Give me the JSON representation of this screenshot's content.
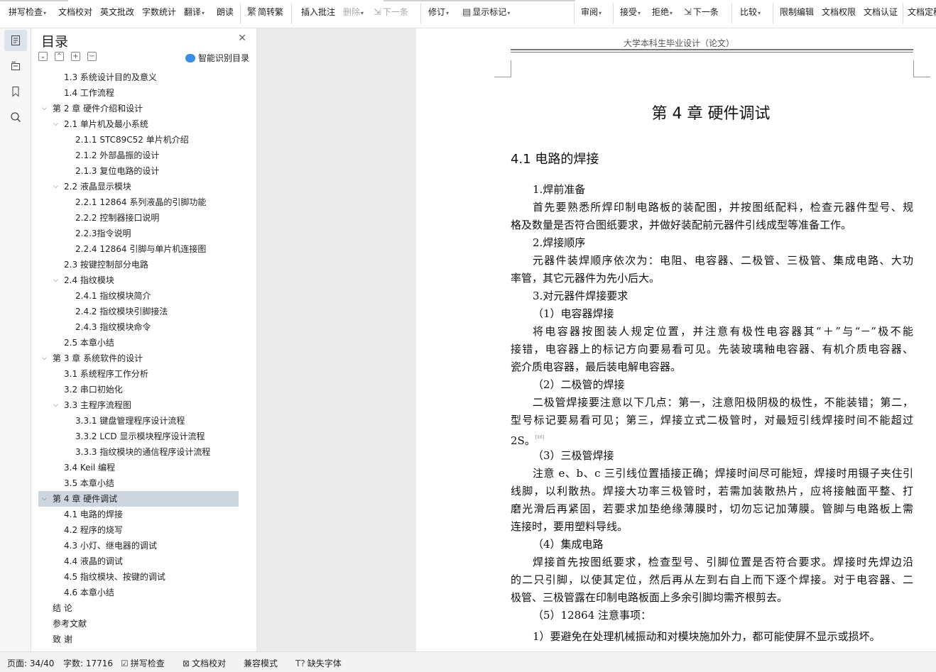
{
  "ribbon": {
    "spell_check": "拼写检查",
    "doc_proof": "文档校对",
    "en_review": "英文批改",
    "word_count": "字数统计",
    "translate": "翻译",
    "read_aloud": "朗读",
    "simp_trad": "简转繁",
    "insert_comment": "插入批注",
    "delete": "删除",
    "next": "下一条",
    "track_changes": "修订",
    "show_markup": "显示标记",
    "review": "审阅",
    "accept": "接受",
    "reject": "拒绝",
    "next_change": "下一条",
    "compare": "比较",
    "restrict_edit": "限制编辑",
    "doc_permission": "文档权限",
    "doc_cert": "文档认证",
    "doc_final": "文档定稿"
  },
  "toc": {
    "title": "目录",
    "smart_label": "智能识别目录",
    "items": [
      {
        "label": "1.3  系统设计目的及意义",
        "level": 2,
        "toggle": ""
      },
      {
        "label": "1.4  工作流程",
        "level": 2,
        "toggle": ""
      },
      {
        "label": "第 2 章  硬件介绍和设计",
        "level": 1,
        "toggle": "v"
      },
      {
        "label": "2.1  单片机及最小系统",
        "level": 2,
        "toggle": "v"
      },
      {
        "label": "2.1.1 STC89C52 单片机介绍",
        "level": 3,
        "toggle": ""
      },
      {
        "label": "2.1.2  外部晶振的设计",
        "level": 3,
        "toggle": ""
      },
      {
        "label": "2.1.3  复位电路的设计",
        "level": 3,
        "toggle": ""
      },
      {
        "label": "2.2  液晶显示模块",
        "level": 2,
        "toggle": "v"
      },
      {
        "label": "2.2.1 12864 系列液晶的引脚功能",
        "level": 3,
        "toggle": ""
      },
      {
        "label": "2.2.2  控制器接口说明",
        "level": 3,
        "toggle": ""
      },
      {
        "label": "2.2.3指令说明",
        "level": 3,
        "toggle": ""
      },
      {
        "label": "2.2.4 12864 引脚与单片机连接图",
        "level": 3,
        "toggle": ""
      },
      {
        "label": "2.3  按键控制部分电路",
        "level": 2,
        "toggle": ""
      },
      {
        "label": "2.4  指纹模块",
        "level": 2,
        "toggle": "v"
      },
      {
        "label": "2.4.1  指纹模块简介",
        "level": 3,
        "toggle": ""
      },
      {
        "label": "2.4.2  指纹模块引脚接法",
        "level": 3,
        "toggle": ""
      },
      {
        "label": "2.4.3  指纹模块命令",
        "level": 3,
        "toggle": ""
      },
      {
        "label": "2.5  本章小结",
        "level": 2,
        "toggle": ""
      },
      {
        "label": "第 3 章  系统软件的设计",
        "level": 1,
        "toggle": "v"
      },
      {
        "label": "3.1  系统程序工作分析",
        "level": 2,
        "toggle": ""
      },
      {
        "label": "3.2  串口初始化",
        "level": 2,
        "toggle": ""
      },
      {
        "label": "3.3  主程序流程图",
        "level": 2,
        "toggle": "v"
      },
      {
        "label": "3.3.1  键盘管理程序设计流程",
        "level": 3,
        "toggle": ""
      },
      {
        "label": "3.3.2 LCD 显示模块程序设计流程",
        "level": 3,
        "toggle": ""
      },
      {
        "label": "3.3.3  指纹模块的通信程序设计流程",
        "level": 3,
        "toggle": ""
      },
      {
        "label": "3.4 Keil 编程",
        "level": 2,
        "toggle": ""
      },
      {
        "label": "3.5  本章小结",
        "level": 2,
        "toggle": ""
      },
      {
        "label": "第 4 章  硬件调试",
        "level": 1,
        "toggle": "v",
        "selected": true
      },
      {
        "label": "4.1  电路的焊接",
        "level": 2,
        "toggle": ""
      },
      {
        "label": "4.2  程序的烧写",
        "level": 2,
        "toggle": ""
      },
      {
        "label": "4.3  小灯、继电器的调试",
        "level": 2,
        "toggle": ""
      },
      {
        "label": "4.4  液晶的调试",
        "level": 2,
        "toggle": ""
      },
      {
        "label": "4.5  指纹模块、按键的调试",
        "level": 2,
        "toggle": ""
      },
      {
        "label": "4.6  本章小结",
        "level": 2,
        "toggle": ""
      },
      {
        "label": "结  论",
        "level": 1,
        "toggle": ""
      },
      {
        "label": "参考文献",
        "level": 1,
        "toggle": ""
      },
      {
        "label": "致  谢",
        "level": 1,
        "toggle": ""
      }
    ]
  },
  "document": {
    "header": "大学本科生毕业设计（论文）",
    "chapter_title": "第 4 章  硬件调试",
    "section_title": "4.1  电路的焊接",
    "lines": [
      {
        "text": "1.焊前准备",
        "indent": true,
        "justify": false
      },
      {
        "text": "首先要熟悉所焊印制电路板的装配图，并按图纸配料，检查元器件型号、规",
        "indent": true,
        "justify": true
      },
      {
        "text": "格及数量是否符合图纸要求，并做好装配前元器件引线成型等准备工作。",
        "indent": false,
        "justify": false
      },
      {
        "text": "2.焊接顺序",
        "indent": true,
        "justify": false
      },
      {
        "text": "元器件装焊顺序依次为：电阻、电容器、二极管、三极管、集成电路、大功",
        "indent": true,
        "justify": true
      },
      {
        "text": "率管，其它元器件为先小后大。",
        "indent": false,
        "justify": false
      },
      {
        "text": "3.对元器件焊接要求",
        "indent": true,
        "justify": false
      },
      {
        "text": "（1）电容器焊接",
        "indent": true,
        "justify": false
      },
      {
        "text": "将电容器按图装人规定位置，并注意有极性电容器其“＋”与“－”极不能",
        "indent": true,
        "justify": true
      },
      {
        "text": "接错，电容器上的标记方向要易看可见。先装玻璃釉电容器、有机介质电容器、",
        "indent": false,
        "justify": true
      },
      {
        "text": "瓷介质电容器，最后装电解电容器。",
        "indent": false,
        "justify": false
      },
      {
        "text": "（2）二极管的焊接",
        "indent": true,
        "justify": false
      },
      {
        "text": "二极管焊接要注意以下几点：第一，注意阳极阴极的极性，不能装错；第二，",
        "indent": true,
        "justify": true
      },
      {
        "text": "型号标记要易看可见；第三，焊接立式二极管时，对最短引线焊接时间不能超过",
        "indent": false,
        "justify": true
      },
      {
        "text": "2S。",
        "indent": false,
        "justify": false,
        "ref": "[16]"
      },
      {
        "text": "（3）三极管焊接",
        "indent": true,
        "justify": false
      },
      {
        "text": "注意 e、b、c 三引线位置插接正确；焊接时间尽可能短，焊接时用镊子夹住引",
        "indent": true,
        "justify": true
      },
      {
        "text": "线脚，以利散热。焊接大功率三极管时，若需加装散热片，应将接触面平整、打",
        "indent": false,
        "justify": true
      },
      {
        "text": "磨光滑后再紧固，若要求加垫绝缘薄膜时，切勿忘记加薄膜。管脚与电路板上需",
        "indent": false,
        "justify": true
      },
      {
        "text": "连接时，要用塑料导线。",
        "indent": false,
        "justify": false
      },
      {
        "text": "（4）集成电路",
        "indent": true,
        "justify": false
      },
      {
        "text": "焊接首先按图纸要求，检查型号、引脚位置是否符合要求。焊接时先焊边沿",
        "indent": true,
        "justify": true
      },
      {
        "text": "的二只引脚，以使其定位，然后再从左到右自上而下逐个焊接。对于电容器、二",
        "indent": false,
        "justify": true
      },
      {
        "text": "极管、三极管露在印制电路板面上多余引脚均需齐根剪去。",
        "indent": false,
        "justify": false
      },
      {
        "text": "（5）12864 注意事项：",
        "indent": true,
        "justify": false
      },
      {
        "text": "1）要避免在处理机械振动和对模块施加外力，都可能使屏不显示或损坏。",
        "indent": true,
        "justify": false
      }
    ]
  },
  "status": {
    "page": "页面: 34/40",
    "words": "字数: 17716",
    "spell": "拼写检查",
    "proof": "文档校对",
    "compat": "兼容模式",
    "missing_font": "缺失字体"
  }
}
